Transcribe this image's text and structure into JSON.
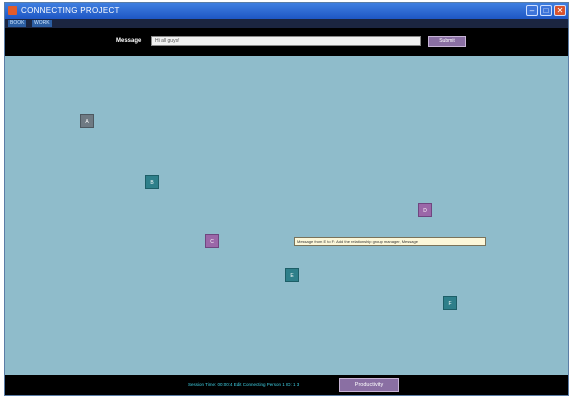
{
  "window": {
    "title": "CONNECTING PROJECT"
  },
  "menubar": {
    "items": [
      "BOOK",
      "WORK"
    ]
  },
  "toolbar": {
    "message_label": "Message",
    "message_value": "Hi all guys!",
    "submit_label": "Submit"
  },
  "canvas": {
    "nodes": [
      {
        "label": "A",
        "color": "#6f7a83"
      },
      {
        "label": "B",
        "color": "#2e7f8a"
      },
      {
        "label": "C",
        "color": "#9b67a8"
      },
      {
        "label": "D",
        "color": "#9b67a8"
      },
      {
        "label": "E",
        "color": "#2e7f8a"
      },
      {
        "label": "F",
        "color": "#2e7f8a"
      }
    ],
    "tooltip": "Message from E to F: Add the relationship group manager, Message"
  },
  "statusbar": {
    "text": "Session Time: 00:00:4  Edit Connecting Person 1 ID: 1 3",
    "button_label": "Productivity"
  },
  "colors": {
    "background": "#8fbccb",
    "titlebar": "#1e56c4",
    "button_purple": "#8a6fa3",
    "status_text": "#3fd0e4"
  }
}
